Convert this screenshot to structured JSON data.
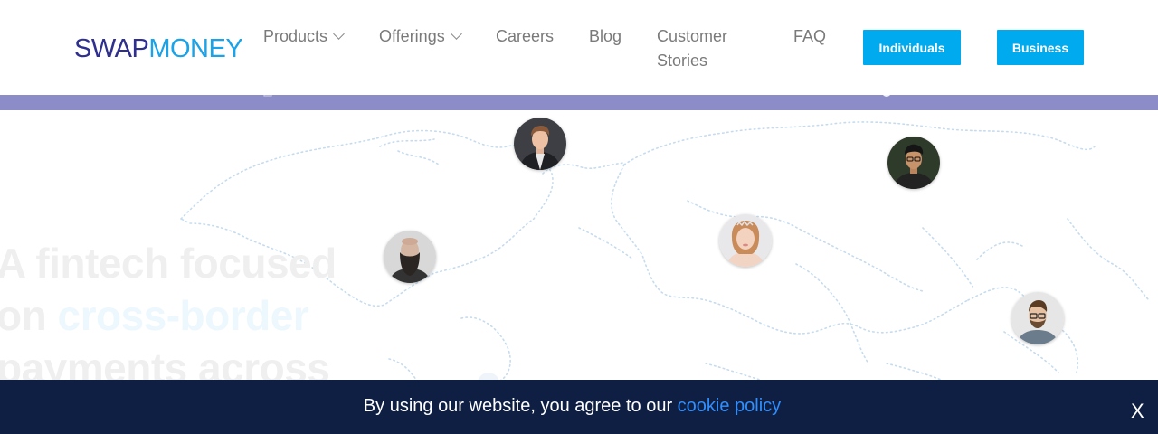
{
  "header": {
    "logo": {
      "swap": "SWAP",
      "money": "MONEY"
    },
    "nav": {
      "products": "Products",
      "offerings": "Offerings",
      "careers": "Careers",
      "blog": "Blog",
      "customer_stories": "Customer Stories",
      "faq": "FAQ"
    },
    "buttons": {
      "individuals": "Individuals",
      "business": "Business"
    }
  },
  "hero": {
    "headline_line1": "A fintech focused",
    "headline_on": "on ",
    "headline_accent": "cross-border",
    "headline_line3": "payments across"
  },
  "cookie_banner": {
    "text": "By using our website, you agree to our ",
    "link": "cookie policy",
    "close": "X"
  },
  "colors": {
    "brand_navy": "#2e2f8f",
    "brand_blue": "#1aa3e8",
    "button_blue": "#00aaee",
    "banner_purple": "#8c8cc8",
    "cookie_bg": "#0f1f44",
    "link_blue": "#2f8fff"
  }
}
